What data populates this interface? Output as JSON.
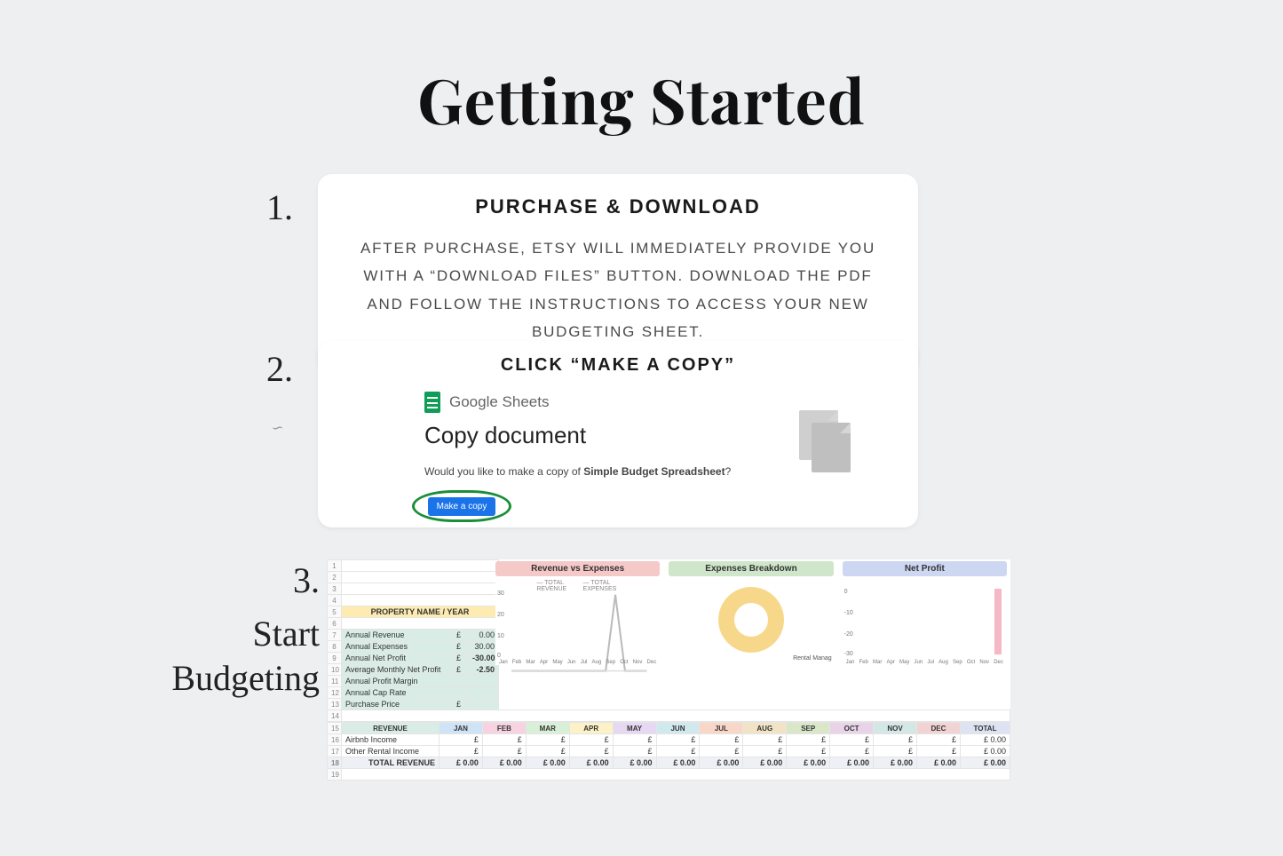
{
  "title": "Getting Started",
  "step1": {
    "num": "1.",
    "heading": "PURCHASE & DOWNLOAD",
    "body": "AFTER PURCHASE, ETSY WILL IMMEDIATELY PROVIDE YOU WITH A “DOWNLOAD FILES” BUTTON. DOWNLOAD THE PDF AND FOLLOW THE INSTRUCTIONS TO ACCESS YOUR NEW BUDGETING SHEET."
  },
  "step2": {
    "num": "2.",
    "heading": "CLICK “MAKE A COPY”",
    "gs_label": "Google Sheets",
    "copy_doc": "Copy document",
    "question_pre": "Would you like to make a copy of ",
    "question_bold": "Simple Budget Spreadsheet",
    "question_post": "?",
    "button": "Make a copy"
  },
  "step3": {
    "num": "3.",
    "caption_l1": "Start",
    "caption_l2": "Budgeting",
    "prop_header": "PROPERTY NAME / YEAR",
    "metrics": [
      {
        "row": "7",
        "label": "Annual Revenue",
        "cur": "£",
        "val": "0.00"
      },
      {
        "row": "8",
        "label": "Annual Expenses",
        "cur": "£",
        "val": "30.00"
      },
      {
        "row": "9",
        "label": "Annual Net Profit",
        "cur": "£",
        "val": "-30.00"
      },
      {
        "row": "10",
        "label": "Average Monthly Net Profit",
        "cur": "£",
        "val": "-2.50"
      },
      {
        "row": "11",
        "label": "Annual Profit Margin",
        "cur": "",
        "val": ""
      },
      {
        "row": "12",
        "label": "Annual Cap Rate",
        "cur": "",
        "val": ""
      },
      {
        "row": "13",
        "label": "Purchase Price",
        "cur": "£",
        "val": ""
      }
    ],
    "charts": {
      "rev_exp": {
        "title": "Revenue vs Expenses",
        "legend": [
          "TOTAL REVENUE",
          "TOTAL EXPENSES"
        ],
        "yticks": [
          "30",
          "20",
          "10",
          "0"
        ]
      },
      "exp_brk": {
        "title": "Expenses Breakdown",
        "label": "Rental Manag"
      },
      "net": {
        "title": "Net Profit",
        "yticks": [
          "0",
          "-10",
          "-20",
          "-30"
        ]
      }
    },
    "months_axis": [
      "Jan",
      "Feb",
      "Mar",
      "Apr",
      "May",
      "Jun",
      "Jul",
      "Aug",
      "Sep",
      "Oct",
      "Nov",
      "Dec"
    ],
    "month_headers": [
      "REVENUE",
      "JAN",
      "FEB",
      "MAR",
      "APR",
      "MAY",
      "JUN",
      "JUL",
      "AUG",
      "SEP",
      "OCT",
      "NOV",
      "DEC",
      "TOTAL"
    ],
    "rows": [
      {
        "row": "16",
        "label": "Airbnb Income",
        "vals": [
          "£",
          "£",
          "£",
          "£",
          "£",
          "£",
          "£",
          "£",
          "£",
          "£",
          "£",
          "£"
        ],
        "total": "£        0.00"
      },
      {
        "row": "17",
        "label": "Other Rental Income",
        "vals": [
          "£",
          "£",
          "£",
          "£",
          "£",
          "£",
          "£",
          "£",
          "£",
          "£",
          "£",
          "£"
        ],
        "total": "£        0.00"
      }
    ],
    "total_row": {
      "row": "18",
      "label": "TOTAL REVENUE",
      "vals": [
        "£      0.00",
        "£      0.00",
        "£      0.00",
        "£      0.00",
        "£      0.00",
        "£      0.00",
        "£      0.00",
        "£      0.00",
        "£      0.00",
        "£      0.00",
        "£      0.00",
        "£      0.00"
      ],
      "total": "£        0.00"
    }
  }
}
